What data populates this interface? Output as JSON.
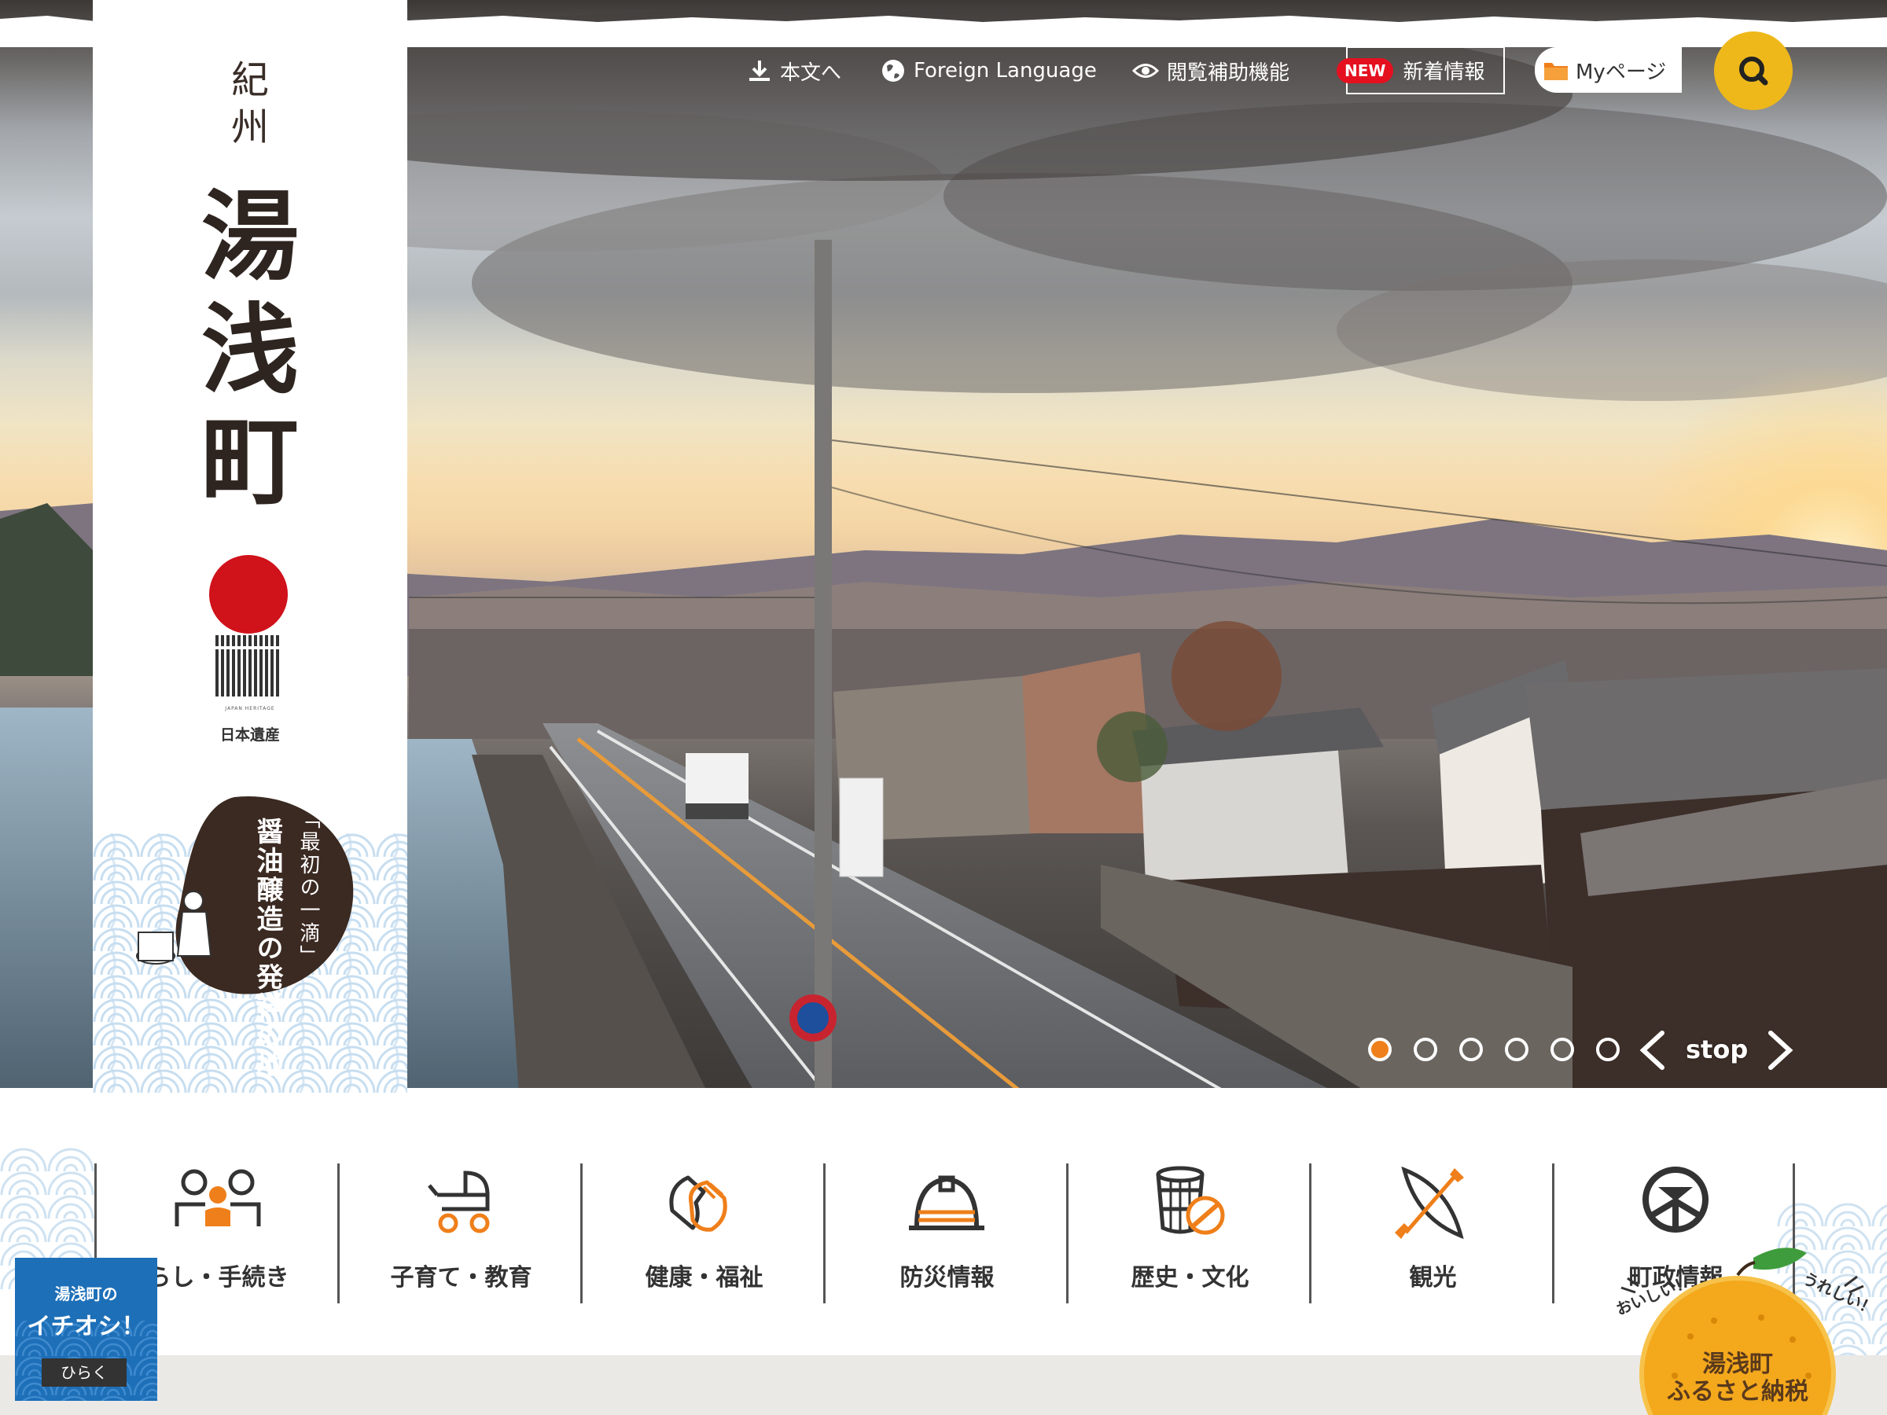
{
  "header": {
    "skip_label": "本文へ",
    "foreign_label": "Foreign Language",
    "accessibility_label": "閲覧補助機能",
    "new_badge": "NEW",
    "news_label": "新着情報",
    "mypage_label": "Myページ"
  },
  "logo": {
    "line_small_1": "紀",
    "line_small_2": "州",
    "big_1": "湯",
    "big_2": "浅",
    "big_3": "町",
    "heritage_en": "JAPAN HERITAGE",
    "heritage_jp": "日本遺産",
    "badge_line1": "「最初の一滴」",
    "badge_line2": "醤油醸造の発祥の地"
  },
  "slider": {
    "slide_count": 6,
    "active_index": 0,
    "stop_label": "stop",
    "active_color": "#ef7f1a"
  },
  "categories": [
    {
      "label": "らし・手続き",
      "icon": "people-icon"
    },
    {
      "label": "子育て・教育",
      "icon": "stroller-icon"
    },
    {
      "label": "健康・福祉",
      "icon": "hands-icon"
    },
    {
      "label": "防災情報",
      "icon": "helmet-icon"
    },
    {
      "label": "歴史・文化",
      "icon": "barrel-icon"
    },
    {
      "label": "観光",
      "icon": "kayak-icon"
    },
    {
      "label": "町政情報",
      "icon": "town-emblem-icon"
    }
  ],
  "ichioshi": {
    "line1": "湯浅町の",
    "line2": "イチオシ！",
    "open_label": "ひらく"
  },
  "furusato": {
    "tag_left": "おいしい！",
    "tag_right": "うれしい！",
    "line1": "湯浅町",
    "line2": "ふるさと納税"
  },
  "colors": {
    "accent_orange": "#ef7f1a",
    "search_yellow": "#eeb81a",
    "ichioshi_blue": "#1d6fb8",
    "new_red": "#e5101f",
    "heritage_red": "#d0121b"
  }
}
